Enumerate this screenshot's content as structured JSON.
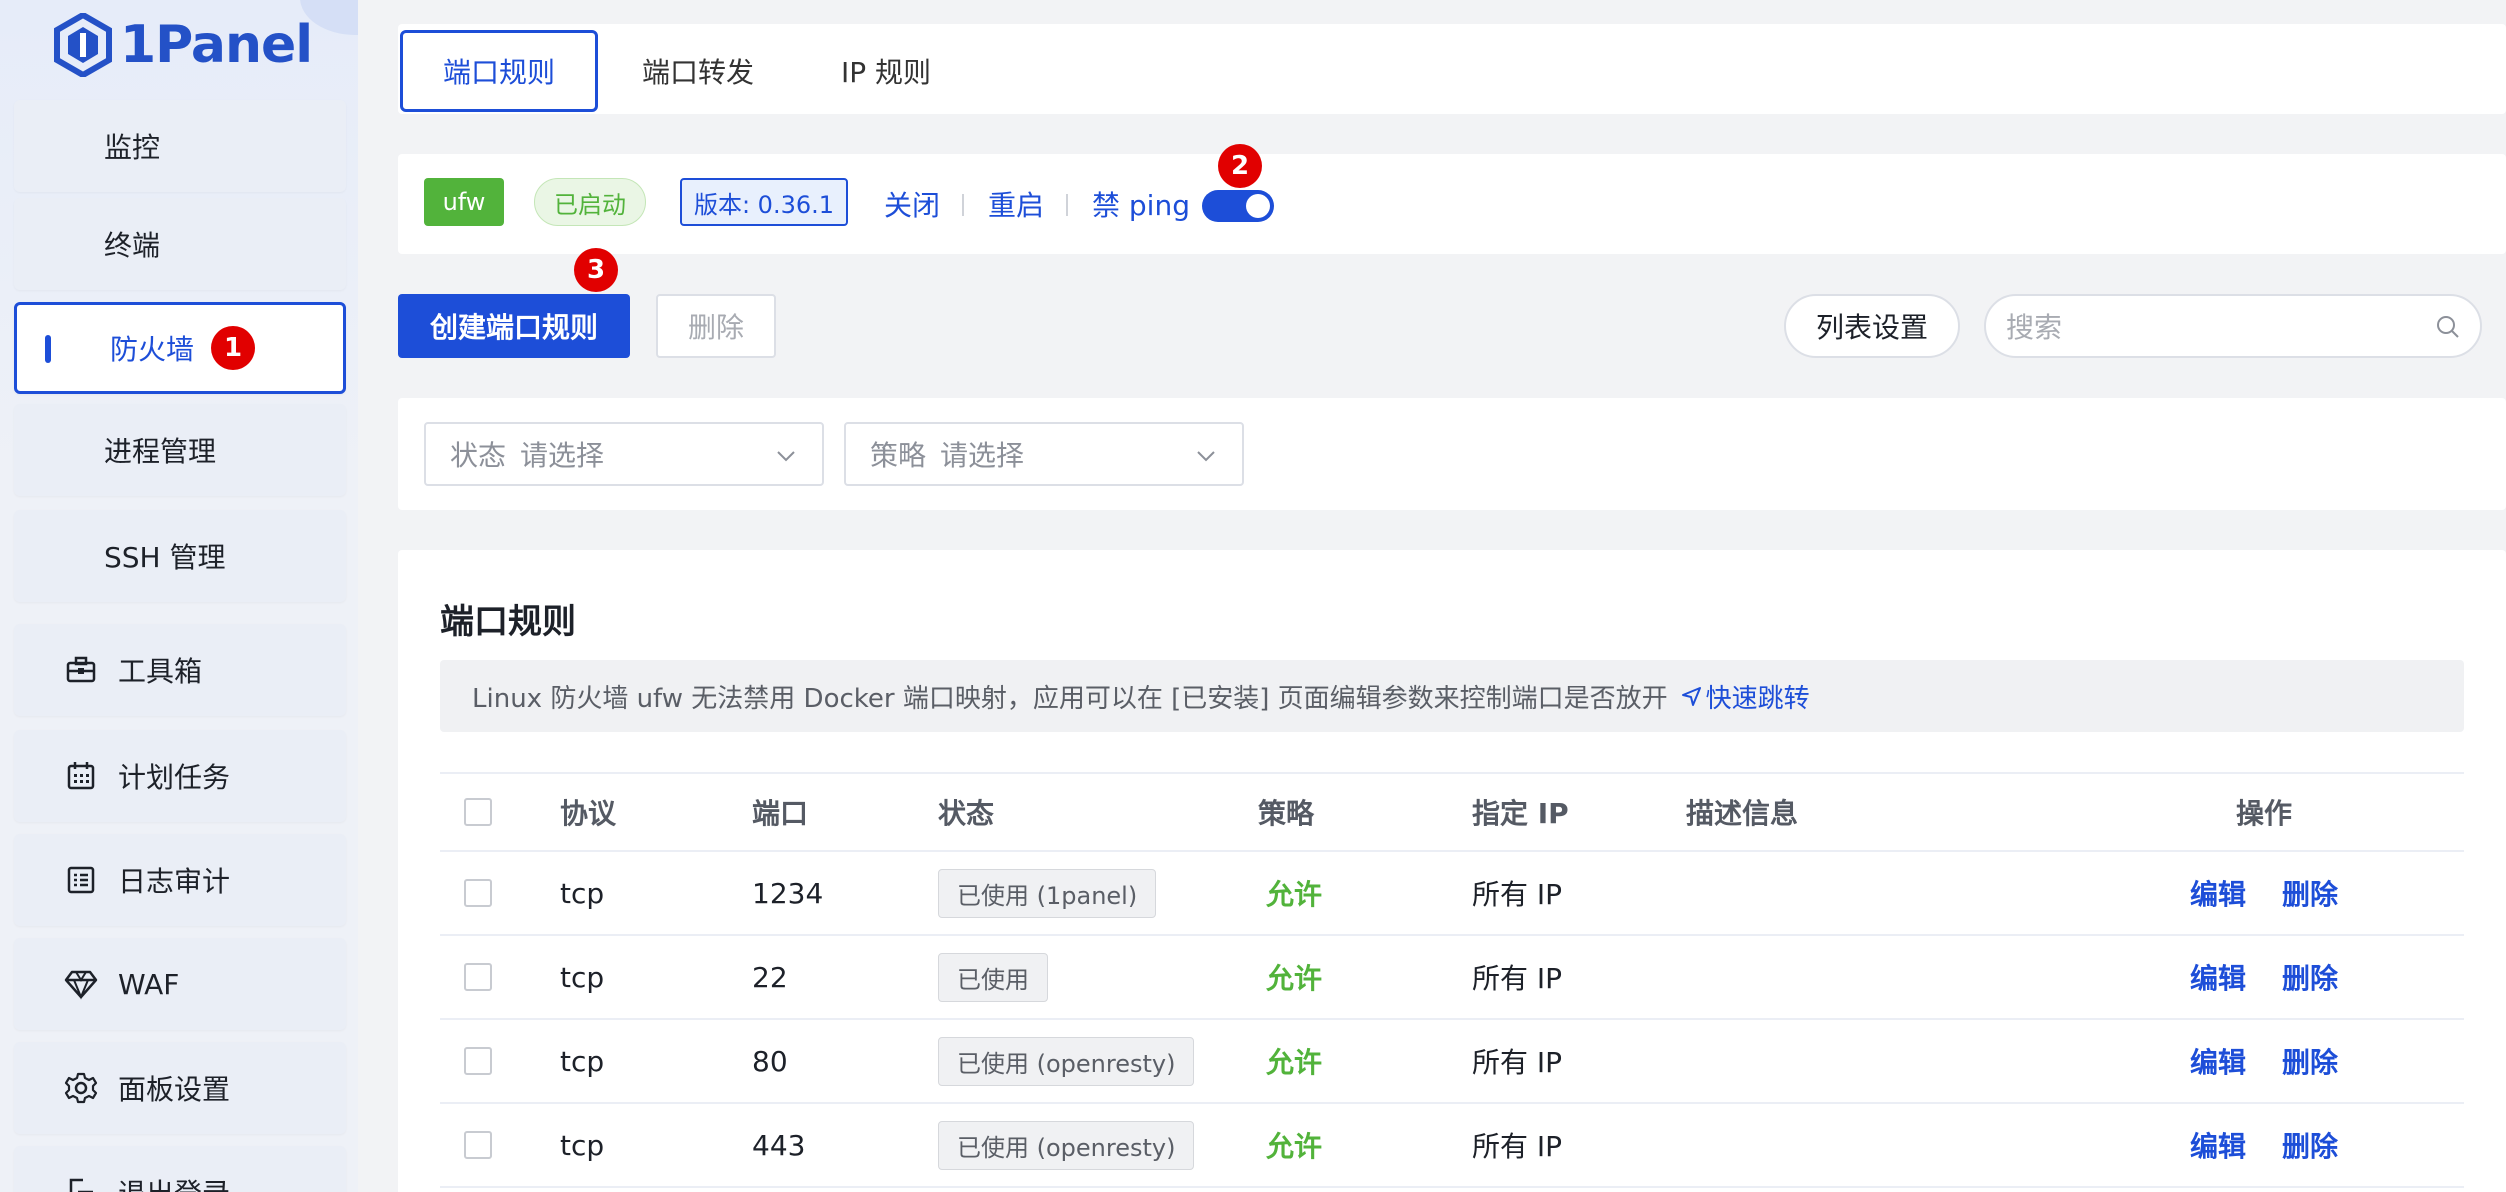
{
  "sidebar": {
    "logo_text": "1Panel",
    "items": [
      {
        "label": "监控",
        "icon": ""
      },
      {
        "label": "终端",
        "icon": ""
      },
      {
        "label": "防火墙",
        "icon": "",
        "badge": "1"
      },
      {
        "label": "进程管理",
        "icon": ""
      },
      {
        "label": "SSH 管理",
        "icon": ""
      },
      {
        "label": "工具箱",
        "icon": "toolbox-icon"
      },
      {
        "label": "计划任务",
        "icon": "calendar-icon"
      },
      {
        "label": "日志审计",
        "icon": "log-icon"
      },
      {
        "label": "WAF",
        "icon": "diamond-icon"
      },
      {
        "label": "面板设置",
        "icon": "gear-icon"
      },
      {
        "label": "退出登录",
        "icon": "logout-icon"
      }
    ]
  },
  "tabs": [
    "端口规则",
    "端口转发",
    "IP 规则"
  ],
  "status": {
    "engine": "ufw",
    "state": "已启动",
    "version": "版本: 0.36.1",
    "stop": "关闭",
    "restart": "重启",
    "ping_label": "禁 ping",
    "ping_badge": "2"
  },
  "toolbar": {
    "create": "创建端口规则",
    "create_badge": "3",
    "delete": "删除",
    "columns": "列表设置",
    "search_placeholder": "搜索"
  },
  "filters": {
    "status": {
      "label": "状态",
      "placeholder": "请选择"
    },
    "policy": {
      "label": "策略",
      "placeholder": "请选择"
    }
  },
  "section": {
    "title": "端口规则",
    "notice": "Linux 防火墙 ufw 无法禁用 Docker 端口映射，应用可以在 [已安装] 页面编辑参数来控制端口是否放开",
    "notice_link": "快速跳转"
  },
  "table": {
    "headers": [
      "协议",
      "端口",
      "状态",
      "策略",
      "指定 IP",
      "描述信息",
      "操作"
    ],
    "rows": [
      {
        "protocol": "tcp",
        "port": "1234",
        "status": "已使用 (1panel)",
        "policy": "允许",
        "ip": "所有 IP",
        "desc": "",
        "edit": "编辑",
        "delete": "删除"
      },
      {
        "protocol": "tcp",
        "port": "22",
        "status": "已使用",
        "policy": "允许",
        "ip": "所有 IP",
        "desc": "",
        "edit": "编辑",
        "delete": "删除"
      },
      {
        "protocol": "tcp",
        "port": "80",
        "status": "已使用 (openresty)",
        "policy": "允许",
        "ip": "所有 IP",
        "desc": "",
        "edit": "编辑",
        "delete": "删除"
      },
      {
        "protocol": "tcp",
        "port": "443",
        "status": "已使用 (openresty)",
        "policy": "允许",
        "ip": "所有 IP",
        "desc": "",
        "edit": "编辑",
        "delete": "删除"
      }
    ]
  },
  "colors": {
    "accent": "#1d4ed8",
    "success": "#52b33b",
    "badge": "#e10000"
  }
}
